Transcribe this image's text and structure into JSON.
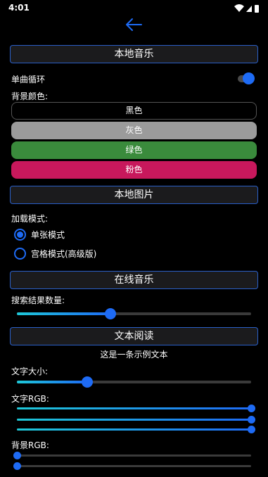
{
  "status": {
    "time": "4:01"
  },
  "sections": {
    "local_music": "本地音乐",
    "local_images": "本地图片",
    "online_music": "在线音乐",
    "text_reading": "文本阅读"
  },
  "local_music": {
    "single_loop_label": "单曲循环",
    "single_loop_on": true,
    "bg_color_label": "背景颜色:",
    "colors": [
      {
        "label": "黑色",
        "color": "#000000"
      },
      {
        "label": "灰色",
        "color": "#9b9b9b"
      },
      {
        "label": "绿色",
        "color": "#3a8b3c"
      },
      {
        "label": "粉色",
        "color": "#c8185c"
      }
    ]
  },
  "local_images": {
    "load_mode_label": "加载模式:",
    "options": [
      {
        "label": "单张模式",
        "selected": true
      },
      {
        "label": "宫格模式(高级版)",
        "selected": false
      }
    ]
  },
  "online_music": {
    "result_count_label": "搜索结果数量:",
    "result_count_level": 0.4
  },
  "text_reading": {
    "sample_text": "这是一条示例文本",
    "font_size_label": "文字大小:",
    "font_size_level": 0.3,
    "text_rgb_label": "文字RGB:",
    "text_rgb_levels": [
      1.0,
      1.0,
      1.0
    ],
    "bg_rgb_label": "背景RGB:",
    "bg_rgb_levels": [
      0.0,
      0.0
    ]
  },
  "colors": {
    "accent": "#1e6bf5",
    "section_border": "#2a5fc8"
  }
}
